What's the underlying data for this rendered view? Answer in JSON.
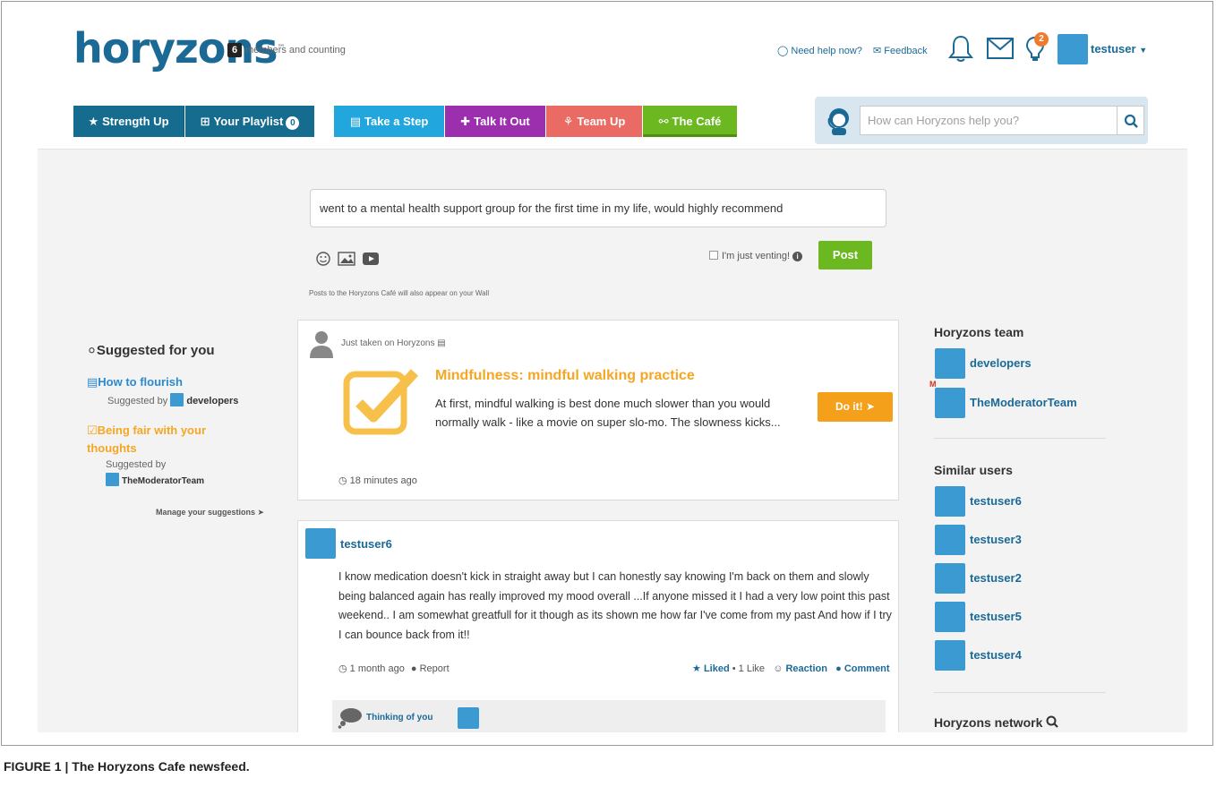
{
  "header": {
    "logo_text": "horyzons",
    "logo_mark": "™",
    "member_count": "6",
    "tagline": "members and counting",
    "help_link": "Need help now?",
    "feedback_link": "Feedback",
    "notification_badge": "2",
    "username": "testuser"
  },
  "nav": {
    "strength_up": "Strength Up",
    "your_playlist": "Your Playlist",
    "playlist_count": "0",
    "take_a_step": "Take a Step",
    "talk_it_out": "Talk It Out",
    "team_up": "Team Up",
    "the_cafe": "The Café",
    "colors": {
      "dark_blue": "#166c8f",
      "cyan": "#21a6dd",
      "purple": "#9b2fae",
      "salmon": "#e96b63",
      "green": "#6bb820"
    }
  },
  "search": {
    "placeholder": "How can Horyzons help you?"
  },
  "composer": {
    "text": "went to a mental health support group for the first time in my life, would highly recommend",
    "venting_label": "I'm just venting!",
    "post_label": "Post",
    "wall_note": "Posts to the Horyzons Café will also appear on your Wall"
  },
  "suggestions": {
    "title": "Suggested for you",
    "items": [
      {
        "label": "How to flourish",
        "by_prefix": "Suggested by",
        "by_user": "developers"
      },
      {
        "label": "Being fair with your thoughts",
        "by_prefix": "Suggested by",
        "by_user": "TheModeratorTeam"
      }
    ],
    "manage_link": "Manage your suggestions"
  },
  "feed": {
    "activity_card": {
      "label": "Just taken on Horyzons",
      "title": "Mindfulness: mindful walking practice",
      "description": "At first, mindful walking is best done much slower than you would normally walk - like a movie on super slo-mo. The slowness kicks...",
      "action_label": "Do it!",
      "time": "18 minutes ago"
    },
    "post": {
      "author": "testuser6",
      "body": "I know medication doesn't kick in straight away but I can honestly say knowing I'm back on them and slowly being balanced again has really improved my mood overall ...If anyone missed it I had a very low point this past weekend.. I am somewhat greatfull for it though as its shown me how far I've come from my past And how if I try I can bounce back from it!!",
      "time": "1 month ago",
      "report": "Report",
      "liked": "Liked",
      "like_count": "1 Like",
      "reaction": "Reaction",
      "comment": "Comment",
      "reaction_label": "Thinking of you"
    }
  },
  "right_sidebar": {
    "team_title": "Horyzons team",
    "team": [
      "developers",
      "TheModeratorTeam"
    ],
    "moderator_mark": "M",
    "similar_title": "Similar users",
    "similar": [
      "testuser6",
      "testuser3",
      "testuser2",
      "testuser5",
      "testuser4"
    ],
    "network_title": "Horyzons network"
  },
  "caption": "FIGURE 1 | The Horyzons Cafe newsfeed."
}
